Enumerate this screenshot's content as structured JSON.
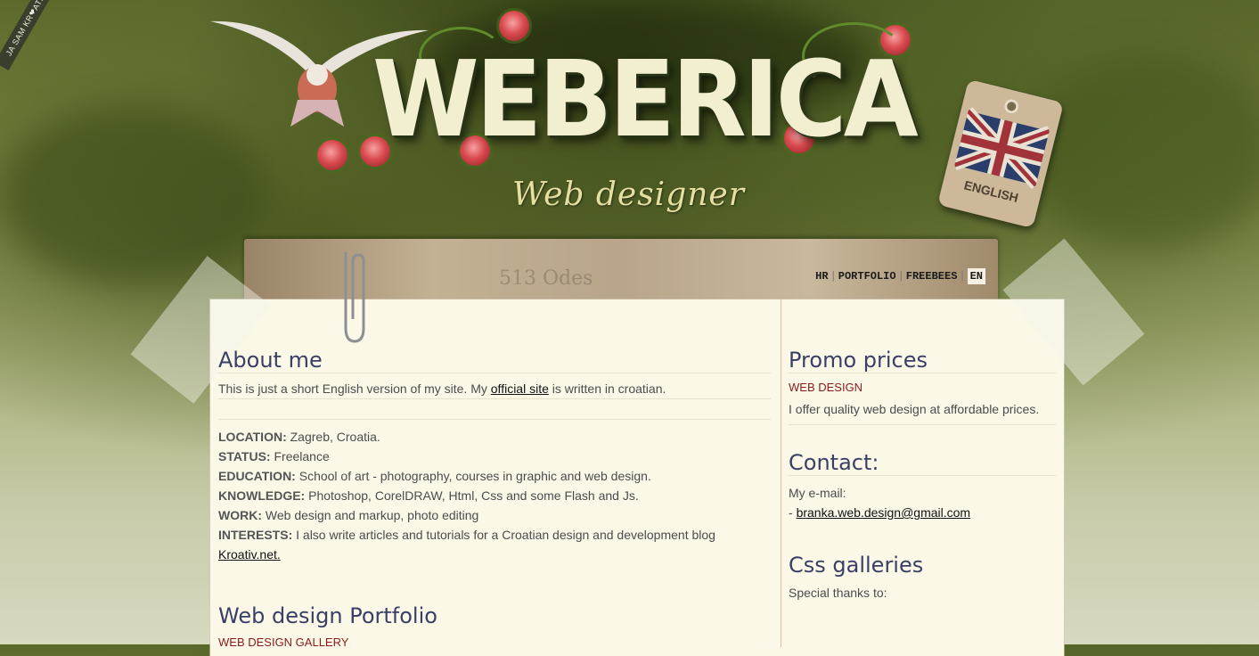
{
  "ribbon": {
    "text": "JA SAM KR❤ATIV"
  },
  "header": {
    "logo": "WEBERICA",
    "tagline": "Web designer",
    "tag_label": "ENGLISH"
  },
  "paper": {
    "stamp": "513 Odes"
  },
  "nav": {
    "items": [
      "HR",
      "PORTFOLIO",
      "FREEBEES",
      "EN"
    ],
    "active": "EN"
  },
  "about": {
    "title": "About me",
    "intro_before": "This is just a short English version of my site. My ",
    "intro_link": "official site",
    "intro_after": " is written in croatian.",
    "rows": [
      {
        "label": "LOCATION:",
        "value": " Zagreb, Croatia."
      },
      {
        "label": "STATUS:",
        "value": " Freelance"
      },
      {
        "label": "EDUCATION:",
        "value": " School of art - photography, courses in graphic and web design."
      },
      {
        "label": "KNOWLEDGE:",
        "value": " Photoshop, CorelDRAW, Html, Css and some Flash and Js."
      },
      {
        "label": "WORK:",
        "value": " Web design and markup, photo editing"
      },
      {
        "label": "INTERESTS:",
        "value": " I also write articles and tutorials for a Croatian design and development blog"
      }
    ],
    "blog_link": "Kroativ.net."
  },
  "portfolio": {
    "title": "Web design Portfolio",
    "sub": "WEB DESIGN GALLERY"
  },
  "promo": {
    "title": "Promo prices",
    "sub": "WEB DESIGN",
    "text": "I offer quality web design at affordable prices."
  },
  "contact": {
    "title": "Contact:",
    "label": "My e-mail:",
    "prefix": "- ",
    "email": "branka.web.design@gmail.com"
  },
  "galleries": {
    "title": "Css galleries",
    "text": "Special thanks to:"
  }
}
